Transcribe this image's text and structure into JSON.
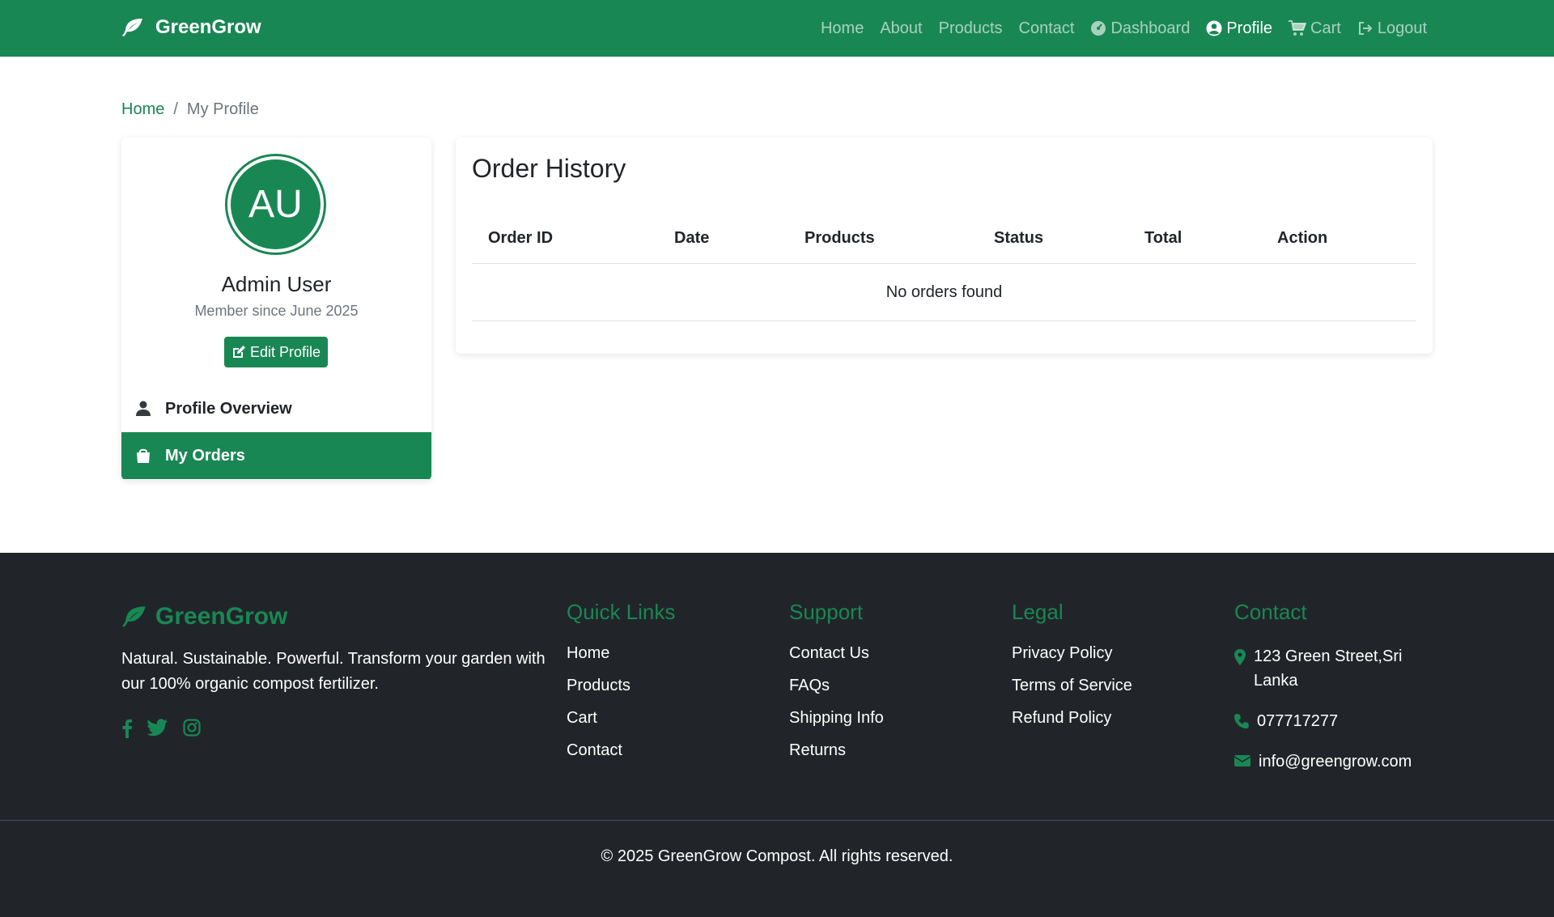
{
  "navbar": {
    "brand": "GreenGrow",
    "links": {
      "home": "Home",
      "about": "About",
      "products": "Products",
      "contact": "Contact",
      "dashboard": "Dashboard",
      "profile": "Profile",
      "cart": "Cart",
      "logout": "Logout"
    },
    "active": "Profile"
  },
  "breadcrumb": {
    "home": "Home",
    "separator": "/",
    "current": "My Profile"
  },
  "profile": {
    "initials": "AU",
    "name": "Admin User",
    "member_since": "Member since June 2025",
    "edit_label": "Edit Profile",
    "menu": {
      "overview": "Profile Overview",
      "orders": "My Orders"
    },
    "active_menu": "My Orders"
  },
  "orders": {
    "title": "Order History",
    "columns": [
      "Order ID",
      "Date",
      "Products",
      "Status",
      "Total",
      "Action"
    ],
    "empty_message": "No orders found"
  },
  "footer": {
    "brand": "GreenGrow",
    "tagline": "Natural. Sustainable. Powerful. Transform your garden with our 100% organic compost fertilizer.",
    "social_icons": [
      "facebook-icon",
      "twitter-icon",
      "instagram-icon"
    ],
    "quick_links": {
      "heading": "Quick Links",
      "items": [
        "Home",
        "Products",
        "Cart",
        "Contact"
      ]
    },
    "support": {
      "heading": "Support",
      "items": [
        "Contact Us",
        "FAQs",
        "Shipping Info",
        "Returns"
      ]
    },
    "legal": {
      "heading": "Legal",
      "items": [
        "Privacy Policy",
        "Terms of Service",
        "Refund Policy"
      ]
    },
    "contact": {
      "heading": "Contact",
      "address": "123 Green Street,Sri Lanka",
      "phone": "077717277",
      "email": "info@greengrow.com"
    },
    "copyright": "© 2025 GreenGrow Compost. All rights reserved."
  },
  "colors": {
    "brand_green": "#198754",
    "footer_bg": "#212529",
    "muted": "#6c757d"
  }
}
